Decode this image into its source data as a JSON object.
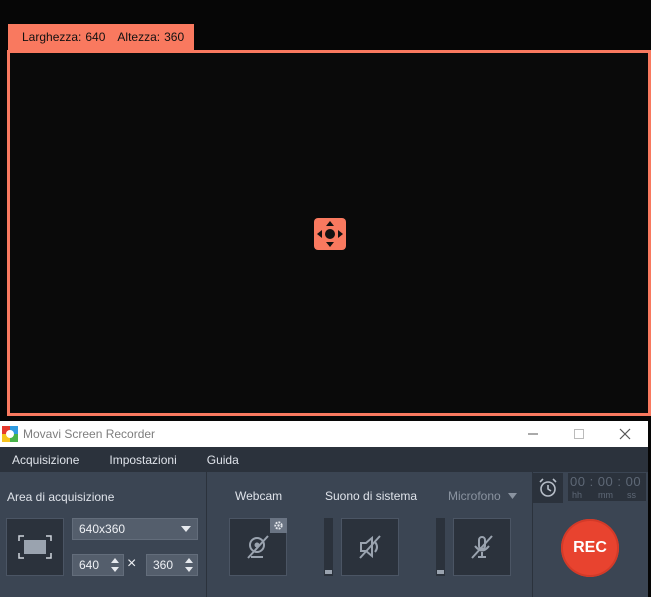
{
  "overlay": {
    "width_label": "Larghezza:",
    "width_value": "640",
    "height_label": "Altezza:",
    "height_value": "360",
    "accent_color": "#f9795f"
  },
  "window": {
    "title": "Movavi Screen Recorder",
    "controls": [
      "minimize-icon",
      "maximize-icon",
      "close-icon"
    ]
  },
  "menu": {
    "items": [
      "Acquisizione",
      "Impostazioni",
      "Guida"
    ]
  },
  "capture": {
    "section_label": "Area di acquisizione",
    "preset": "640x360",
    "width": "640",
    "height": "360",
    "separator": "×"
  },
  "sources": {
    "webcam_label": "Webcam",
    "system_sound_label": "Suono di sistema",
    "microphone_label": "Microfono"
  },
  "timer": {
    "digits": "00 : 00 : 00",
    "hh": "hh",
    "mm": "mm",
    "ss": "ss"
  },
  "rec": {
    "label": "REC",
    "color": "#e8432f"
  }
}
